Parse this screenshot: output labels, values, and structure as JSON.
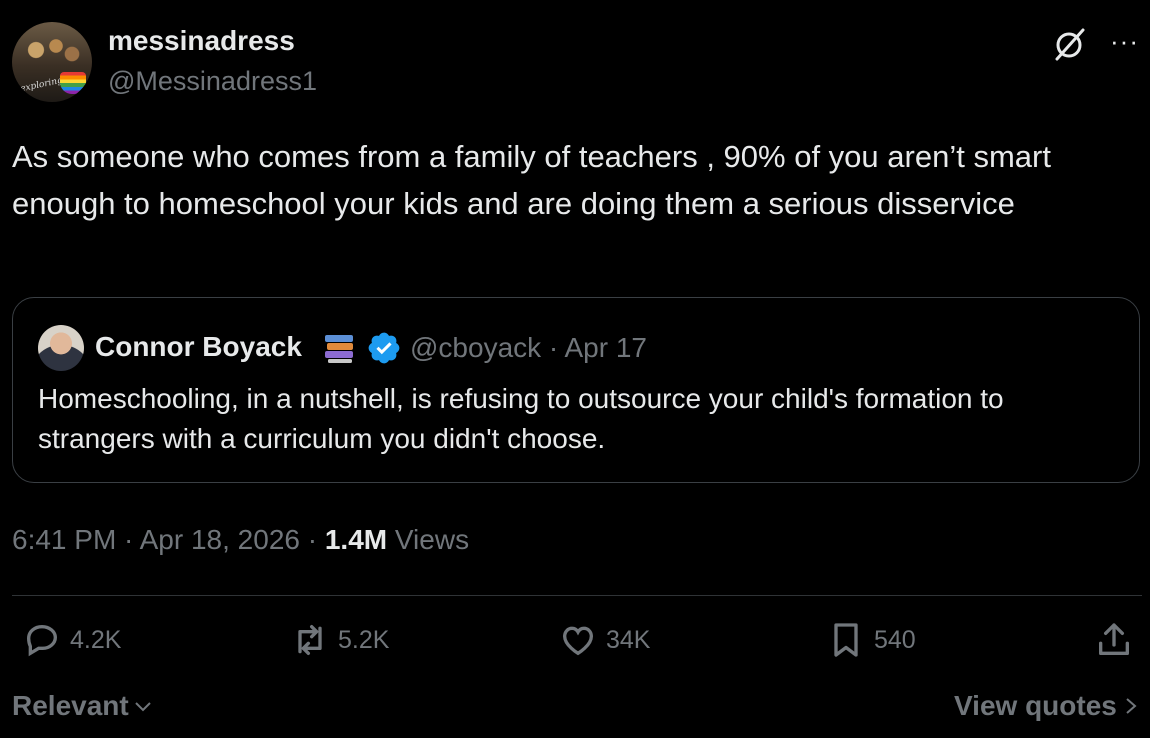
{
  "author": {
    "display_name": "messinadress",
    "handle": "@Messinadress1",
    "avatar_script": "exploring"
  },
  "tweet": {
    "text": "As someone who comes from a family of teachers , 90% of you aren’t smart enough to homeschool your kids and are doing them a serious disservice"
  },
  "quoted": {
    "display_name": "Connor Boyack",
    "handle": "@cboyack",
    "date": "Apr 17",
    "meta_separator": "·",
    "text": "Homeschooling, in a nutshell, is refusing to outsource your child's formation to strangers with a curriculum you didn't choose."
  },
  "timestamp": {
    "time": "6:41 PM",
    "date": "Apr 18, 2026",
    "views_count": "1.4M",
    "views_label": "Views"
  },
  "actions": {
    "replies": "4.2K",
    "reposts": "5.2K",
    "likes": "34K",
    "bookmarks": "540"
  },
  "footer": {
    "sort_label": "Relevant",
    "view_quotes": "View quotes"
  },
  "colors": {
    "background": "#000000",
    "text": "#e7e9ea",
    "secondary": "#71767b",
    "border": "#2f3336",
    "verified": "#1d9bf0"
  },
  "icons": [
    "grok-icon",
    "more-icon",
    "books-emoji-icon",
    "verified-badge-icon",
    "reply-icon",
    "repost-icon",
    "like-icon",
    "bookmark-icon",
    "share-icon",
    "chevron-down-icon",
    "chevron-right-icon"
  ]
}
